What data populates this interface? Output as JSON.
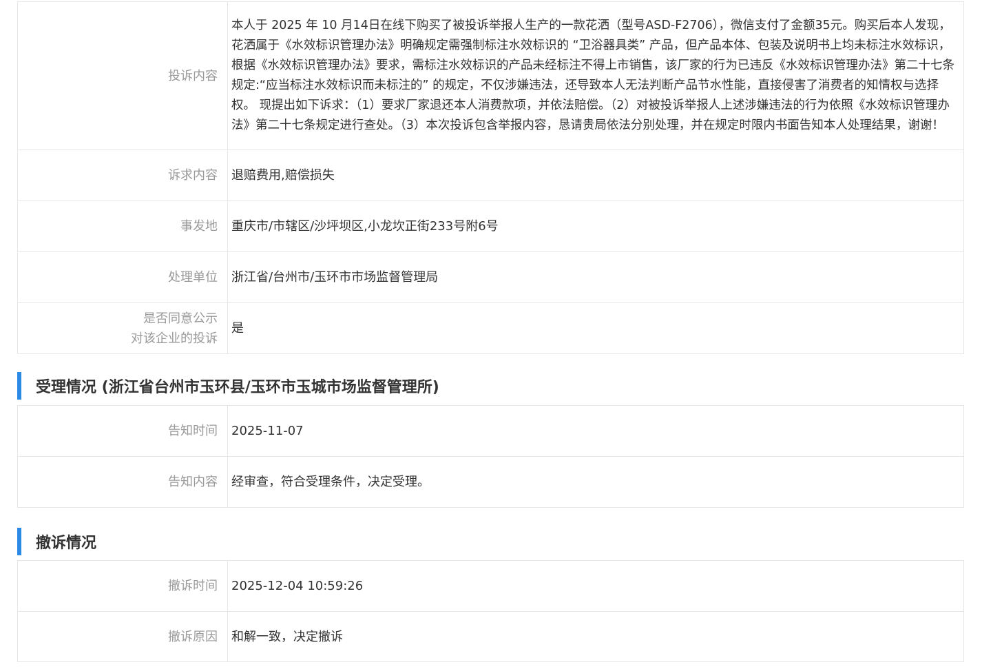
{
  "complaint": {
    "rows": [
      {
        "label": "投诉内容",
        "value": "本人于 2025 年 10 月14日在线下购买了被投诉举报人生产的一款花洒（型号ASD-F2706），微信支付了金额35元。购买后本人发现，花洒属于《水效标识管理办法》明确规定需强制标注水效标识的 “卫浴器具类” 产品，但产品本体、包装及说明书上均未标注水效标识，根据《水效标识管理办法》要求，需标注水效标识的产品未经标注不得上市销售，该厂家的行为已违反《水效标识管理办法》第二十七条规定:“应当标注水效标识而未标注的” 的规定，不仅涉嫌违法，还导致本人无法判断产品节水性能，直接侵害了消费者的知情权与选择权。 现提出如下诉求：（1）要求厂家退还本人消费款项，并依法赔偿。（2）对被投诉举报人上述涉嫌违法的行为依照《水效标识管理办法》第二十七条规定进行查处。（3）本次投诉包含举报内容，恳请贵局依法分别处理，并在规定时限内书面告知本人处理结果，谢谢！"
      },
      {
        "label": "诉求内容",
        "value": "退赔费用,赔偿损失"
      },
      {
        "label": "事发地",
        "value": "重庆市/市辖区/沙坪坝区,小龙坎正街233号附6号"
      },
      {
        "label": "处理单位",
        "value": "浙江省/台州市/玉环市市场监督管理局"
      },
      {
        "label_line1": "是否同意公示",
        "label_line2": "对该企业的投诉",
        "value": "是"
      }
    ]
  },
  "acceptance": {
    "title": "受理情况 (浙江省台州市玉环县/玉环市玉城市场监督管理所)",
    "rows": [
      {
        "label": "告知时间",
        "value": "2025-11-07"
      },
      {
        "label": "告知内容",
        "value": "经审查，符合受理条件，决定受理。"
      }
    ]
  },
  "withdrawal": {
    "title": "撤诉情况",
    "rows": [
      {
        "label": "撤诉时间",
        "value": "2025-12-04 10:59:26"
      },
      {
        "label": "撤诉原因",
        "value": "和解一致，决定撤诉"
      }
    ]
  },
  "colors": {
    "accent": "#2b8ae6",
    "label_text": "#999999",
    "value_text": "#333333",
    "border": "#e6e6e6"
  }
}
